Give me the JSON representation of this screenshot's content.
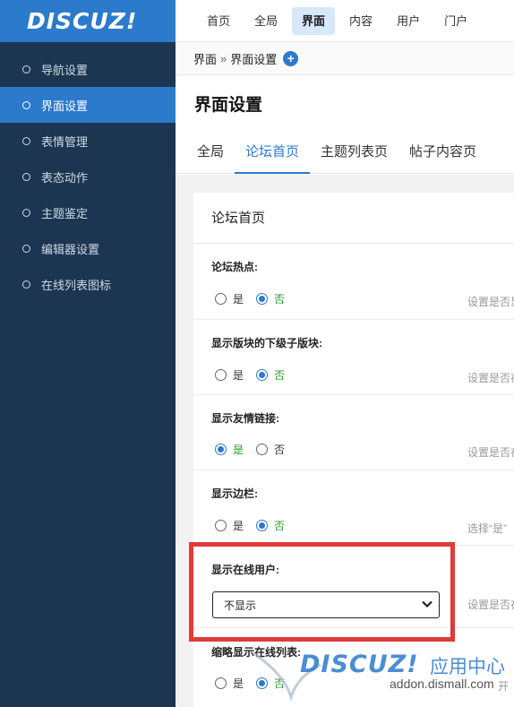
{
  "logo": {
    "text": "DISCUZ!"
  },
  "sidebar": {
    "items": [
      {
        "label": "导航设置"
      },
      {
        "label": "界面设置"
      },
      {
        "label": "表情管理"
      },
      {
        "label": "表态动作"
      },
      {
        "label": "主题鉴定"
      },
      {
        "label": "编辑器设置"
      },
      {
        "label": "在线列表图标"
      }
    ],
    "active_index": 1
  },
  "topnav": {
    "items": [
      "首页",
      "全局",
      "界面",
      "内容",
      "用户",
      "门户"
    ],
    "active_index": 2
  },
  "breadcrumb": {
    "root": "界面",
    "sep": "»",
    "current": "界面设置",
    "plus": "+"
  },
  "page": {
    "title": "界面设置"
  },
  "tabs": {
    "items": [
      "全局",
      "论坛首页",
      "主题列表页",
      "帖子内容页"
    ],
    "active_index": 1
  },
  "panel": {
    "title": "论坛首页",
    "settings": [
      {
        "label": "论坛热点:",
        "yes": "是",
        "no": "否",
        "value": "no",
        "hint": "设置是否显"
      },
      {
        "label": "显示版块的下级子版块:",
        "yes": "是",
        "no": "否",
        "value": "no",
        "hint": "设置是否在"
      },
      {
        "label": "显示友情链接:",
        "yes": "是",
        "no": "否",
        "value": "yes",
        "hint": "设置是否在"
      },
      {
        "label": "显示边栏:",
        "yes": "是",
        "no": "否",
        "value": "no",
        "hint": "选择“是”"
      },
      {
        "label": "显示在线用户:",
        "select_value": "不显示",
        "hint": "设置是否在"
      },
      {
        "label": "缩略显示在线列表:",
        "yes": "是",
        "no": "否",
        "value": "no",
        "hint": "开"
      }
    ]
  },
  "watermark": {
    "logo": "DISCUZ!",
    "cn": "应用中心",
    "url": "addon.dismall.com"
  },
  "colors": {
    "sidebar": "#1c3651",
    "accent": "#2b7acc",
    "highlight": "#e03b3b",
    "checked_text": "#2aa12a"
  }
}
